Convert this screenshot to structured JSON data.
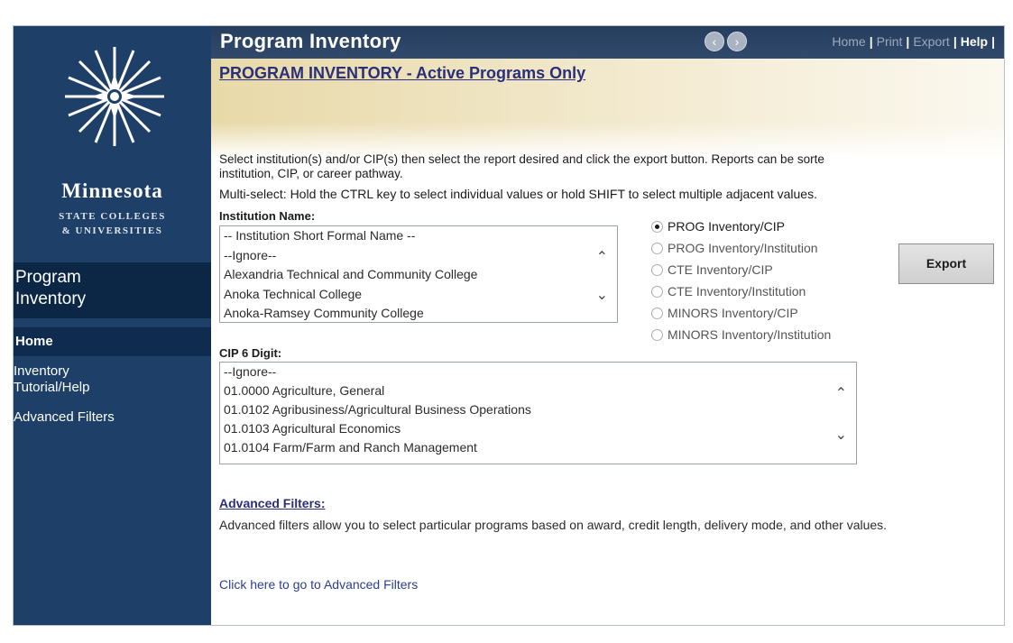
{
  "sidebar": {
    "logo_name": "Minnesota",
    "logo_sub1": "STATE COLLEGES",
    "logo_sub2": "& UNIVERSITIES",
    "section_title_line1": "Program",
    "section_title_line2": "Inventory",
    "home": "Home",
    "link_help_line1": "Inventory",
    "link_help_line2": "Tutorial/Help",
    "link_filters": "Advanced Filters"
  },
  "header": {
    "title": "Program Inventory",
    "links": {
      "home": "Home",
      "print": "Print",
      "export": "Export",
      "help": "Help"
    }
  },
  "page": {
    "heading": "PROGRAM INVENTORY - Active Programs Only",
    "intro": "Select institution(s) and/or CIP(s) then select the report desired and click the export button. Reports can be sorted by institution, CIP, or career pathway.",
    "intro_line1": "Select institution(s) and/or CIP(s) then select the report desired and click the export button. Reports can be sorte",
    "intro_line2": "institution, CIP, or career pathway.",
    "multiselect": "Multi-select: Hold the CTRL key to select individual values or hold SHIFT to select multiple adjacent values.",
    "institution_label": "Institution Name:",
    "institution_options": [
      "-- Institution Short Formal Name --",
      "--Ignore--",
      "Alexandria Technical and Community College",
      "Anoka Technical College",
      "Anoka-Ramsey Community College"
    ],
    "cip_label": "CIP 6 Digit:",
    "cip_options": [
      "--Ignore--",
      "01.0000 Agriculture, General",
      "01.0102 Agribusiness/Agricultural Business Operations",
      "01.0103 Agricultural Economics",
      "01.0104 Farm/Farm and Ranch Management"
    ],
    "reports": [
      {
        "label": "PROG Inventory/CIP",
        "selected": true
      },
      {
        "label": "PROG Inventory/Institution",
        "selected": false
      },
      {
        "label": "CTE Inventory/CIP",
        "selected": false
      },
      {
        "label": "CTE Inventory/Institution",
        "selected": false
      },
      {
        "label": "MINORS Inventory/CIP",
        "selected": false
      },
      {
        "label": "MINORS Inventory/Institution",
        "selected": false
      }
    ],
    "export_button": "Export",
    "advanced_title": "Advanced Filters:",
    "advanced_desc": "Advanced filters allow you to select particular programs based on award, credit length, delivery mode, and other values.",
    "advanced_link": "Click here to go to Advanced Filters"
  },
  "colors": {
    "sidebar_bg": "#1d3f68",
    "header_bg": "#263e5e",
    "heading_text": "#2a2f7a",
    "banner_gold": "#e8d9a8"
  }
}
